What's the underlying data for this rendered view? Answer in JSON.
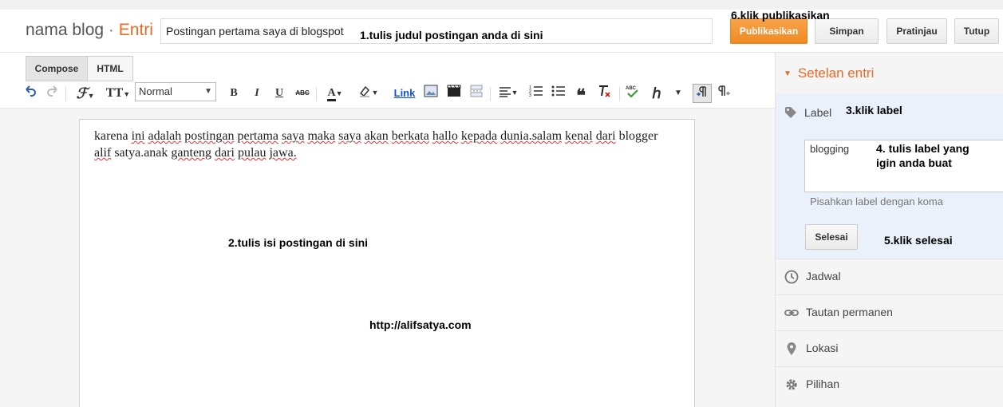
{
  "header": {
    "blog_name": "nama blog",
    "separator": "·",
    "section": "Entri",
    "post_title_value": "Postingan pertama saya di blogspot",
    "buttons": {
      "publish": "Publikasikan",
      "save": "Simpan",
      "preview": "Pratinjau",
      "close": "Tutup"
    }
  },
  "annotations": {
    "step1": "1.tulis judul postingan anda di sini",
    "step2": "2.tulis isi postingan di sini",
    "step3": "3.klik label",
    "step4": "4. tulis label yang igin anda buat",
    "step5": "5.klik selesai",
    "step6": "6.klik publikasikan",
    "url": "http://alifsatya.com"
  },
  "editor": {
    "modes": {
      "compose": "Compose",
      "html": "HTML"
    },
    "format_select": "Normal",
    "link_label": "Link",
    "content": {
      "w1": "karena",
      "w2": "ini",
      "w3": "adalah",
      "w4": "postingan",
      "w5": "pertama",
      "w6": "saya",
      "w7": "maka",
      "w8": "saya",
      "w9": "akan",
      "w10": "berkata",
      "w11": "hallo",
      "w12": "kepada",
      "w13": "dunia.salam",
      "w14": "kenal",
      "w15": "dari",
      "w16": "blogger",
      "w17": "alif",
      "w18": "satya.anak",
      "w19": "ganteng",
      "w20": "dari",
      "w21": "pulau",
      "w22": "jawa."
    }
  },
  "sidebar": {
    "heading": "Setelan entri",
    "label": {
      "title": "Label",
      "value": "blogging",
      "hint": "Pisahkan label dengan koma",
      "done_button": "Selesai"
    },
    "items": [
      {
        "label": "Jadwal",
        "icon": "clock-icon"
      },
      {
        "label": "Tautan permanen",
        "icon": "link-icon"
      },
      {
        "label": "Lokasi",
        "icon": "location-pin-icon"
      },
      {
        "label": "Pilihan",
        "icon": "gear-icon"
      }
    ]
  },
  "colors": {
    "accent_orange": "#e76b23",
    "publish_button": "#f18a22",
    "label_panel": "#eaf1fb"
  }
}
